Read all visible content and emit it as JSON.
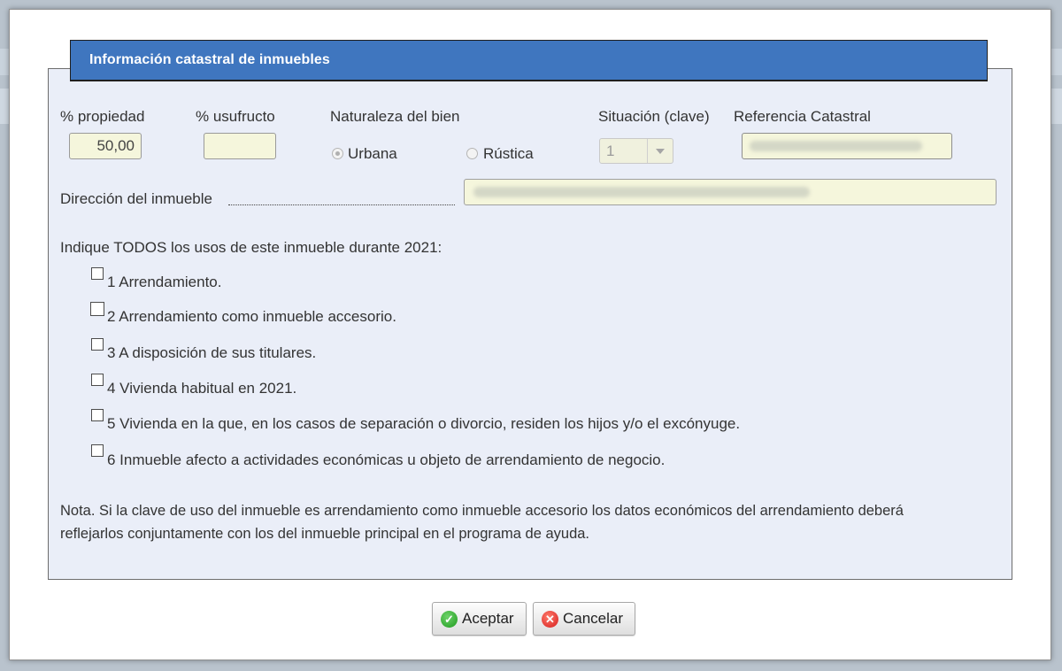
{
  "header": {
    "title": "Información catastral de inmuebles"
  },
  "fields": {
    "propiedad_label": "% propiedad",
    "propiedad_value": "50,00",
    "usufructo_label": "% usufructo",
    "usufructo_value": "",
    "naturaleza_label": "Naturaleza del bien",
    "urbana_label": "Urbana",
    "rustica_label": "Rústica",
    "naturaleza_selected": "Urbana",
    "situacion_label": "Situación (clave)",
    "situacion_value": "1",
    "referencia_label": "Referencia Catastral",
    "direccion_label": "Dirección del inmueble"
  },
  "usos": {
    "prompt": "Indique TODOS los usos de este inmueble durante 2021:",
    "items": [
      {
        "label": "1 Arrendamiento.",
        "checked": false
      },
      {
        "label": "2 Arrendamiento como inmueble accesorio.",
        "checked": false
      },
      {
        "label": "3 A disposición de sus titulares.",
        "checked": false
      },
      {
        "label": "4 Vivienda habitual en 2021.",
        "checked": false
      },
      {
        "label": "5 Vivienda en la que, en los casos de separación o divorcio, residen los hijos y/o el excónyuge.",
        "checked": false
      },
      {
        "label": "6 Inmueble afecto a actividades económicas u objeto de arrendamiento de negocio.",
        "checked": false
      }
    ]
  },
  "nota": {
    "line1": "Nota. Si la clave de uso del inmueble es arrendamiento como inmueble accesorio los datos económicos del arrendamiento deberá",
    "line2": "reflejarlos conjuntamente con los del inmueble principal en el programa de ayuda."
  },
  "buttons": {
    "accept_label": "Aceptar",
    "cancel_label": "Cancelar"
  },
  "icons": {
    "accept": "check-circle-icon",
    "cancel": "x-circle-icon"
  },
  "colors": {
    "header_bg": "#3f76bf",
    "panel_bg": "#eaeef8",
    "field_bg": "#f5f6dc"
  }
}
